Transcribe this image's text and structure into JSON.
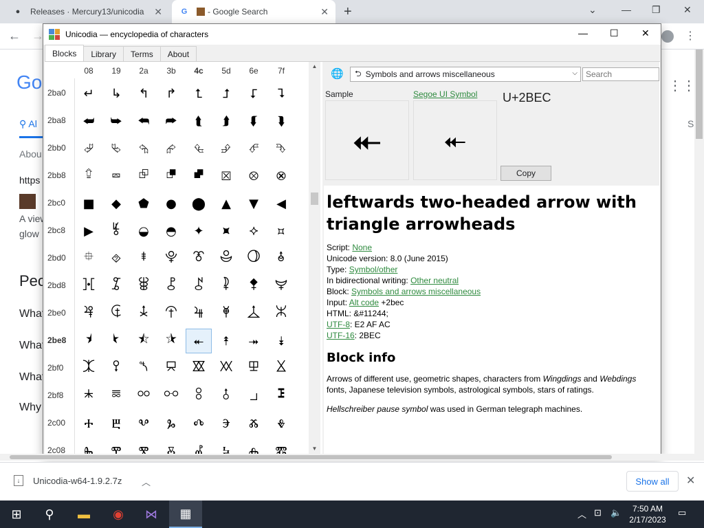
{
  "browser": {
    "tabs": [
      {
        "title": "Releases · Mercury13/unicodia",
        "icon": "github-icon"
      },
      {
        "title": "- Google Search",
        "icon": "google-icon"
      }
    ]
  },
  "google_page": {
    "snippets": [
      "Go",
      "Al",
      "Abou",
      "https",
      "A view",
      "glow",
      "Peo",
      "What",
      "What",
      "What",
      "Why",
      "S"
    ]
  },
  "window": {
    "title": "Unicodia — encyclopedia of characters",
    "tabs": [
      "Blocks",
      "Library",
      "Terms",
      "About"
    ],
    "active_tab": "Blocks"
  },
  "grid": {
    "columns": [
      "08",
      "19",
      "2a",
      "3b",
      "4c",
      "5d",
      "6e",
      "7f"
    ],
    "rows": [
      {
        "label": "2ba0",
        "chars": [
          "↵",
          "↳",
          "↰",
          "↱",
          "⮤",
          "⮥",
          "⮦",
          "⮧"
        ]
      },
      {
        "label": "2ba8",
        "chars": [
          "⮨",
          "⮩",
          "⮪",
          "⮫",
          "⮬",
          "⮭",
          "⮮",
          "⮯"
        ]
      },
      {
        "label": "2bb0",
        "chars": [
          "⮰",
          "⮱",
          "⮲",
          "⮳",
          "⮴",
          "⮵",
          "⮶",
          "⮷"
        ]
      },
      {
        "label": "2bb8",
        "chars": [
          "⮸",
          "⮹",
          "⮺",
          "⮻",
          "⮼",
          "⮽",
          "⮾",
          "⮿"
        ]
      },
      {
        "label": "2bc0",
        "chars": [
          "■",
          "◆",
          "⬟",
          "●",
          "⬤",
          "▲",
          "▼",
          "◀"
        ]
      },
      {
        "label": "2bc8",
        "chars": [
          "▶",
          "⯉",
          "◒",
          "◓",
          "✦",
          "⯍",
          "⯎",
          "⯏"
        ]
      },
      {
        "label": "2bd0",
        "chars": [
          "⯐",
          "⯑",
          "⯒",
          "⯓",
          "⯔",
          "⯕",
          "⯖",
          "⯗"
        ]
      },
      {
        "label": "2bd8",
        "chars": [
          "⯘",
          "⯙",
          "⯚",
          "⯛",
          "⯜",
          "⯝",
          "⯞",
          "⯟"
        ]
      },
      {
        "label": "2be0",
        "chars": [
          "⯠",
          "⯡",
          "⯢",
          "⯣",
          "⯤",
          "⯥",
          "⯦",
          "⯧"
        ]
      },
      {
        "label": "2be8",
        "chars": [
          "⯨",
          "⯩",
          "⯪",
          "⯫",
          "⯬",
          "⯭",
          "⯮",
          "⯯"
        ]
      },
      {
        "label": "2bf0",
        "chars": [
          "⯰",
          "⯱",
          "⯲",
          "⯳",
          "⯴",
          "⯵",
          "⯶",
          "⯷"
        ]
      },
      {
        "label": "2bf8",
        "chars": [
          "⯸",
          "⯹",
          "⯺",
          "⯻",
          "⯼",
          "⯽",
          "⯾",
          "⯿"
        ]
      },
      {
        "label": "2c00",
        "chars": [
          "Ⰰ",
          "Ⰱ",
          "Ⰲ",
          "Ⰳ",
          "Ⰴ",
          "Ⰵ",
          "Ⰶ",
          "Ⰷ"
        ]
      },
      {
        "label": "2c08",
        "chars": [
          "Ⰸ",
          "Ⰹ",
          "Ⰺ",
          "Ⰻ",
          "Ⰼ",
          "Ⰽ",
          "Ⰾ",
          "Ⰿ"
        ]
      }
    ],
    "selected": {
      "row": 9,
      "col": 4
    }
  },
  "panel": {
    "block_select": "Symbols and arrows miscellaneous",
    "search_placeholder": "Search",
    "sample_label": "Sample",
    "font_label": "Segoe UI Symbol",
    "sample_char": "⯬",
    "codepoint": "U+2BEC",
    "copy_label": "Copy",
    "char_name": "leftwards two-headed arrow with triangle arrowheads",
    "props": {
      "script_label": "Script: ",
      "script_value": "None",
      "version_text": "Unicode version: 8.0 (June 2015)",
      "type_label": "Type: ",
      "type_value": "Symbol/other",
      "bidi_label": "In bidirectional writing: ",
      "bidi_value": "Other neutral",
      "block_label": "Block: ",
      "block_value": "Symbols and arrows miscellaneous",
      "input_label": "Input: ",
      "input_link": "Alt code",
      "input_rest": " +2bec",
      "html_text": "HTML: &#11244;",
      "utf8_link": "UTF-8",
      "utf8_rest": ": E2 AF AC",
      "utf16_link": "UTF-16",
      "utf16_rest": ": 2BEC"
    },
    "block_info_title": "Block info",
    "block_info_p1_a": "Arrows of different use, geometric shapes, characters from ",
    "block_info_p1_b": "Wingdings",
    "block_info_p1_c": " and ",
    "block_info_p1_d": "Webdings",
    "block_info_p1_e": " fonts, Japanese television symbols, astrological symbols, stars of ratings.",
    "block_info_p2_a": "Hellschreiber pause symbol",
    "block_info_p2_b": " was used in German telegraph machines."
  },
  "download": {
    "file": "Unicodia-w64-1.9.2.7z",
    "show_all": "Show all"
  },
  "taskbar": {
    "time": "7:50 AM",
    "date": "2/17/2023"
  }
}
